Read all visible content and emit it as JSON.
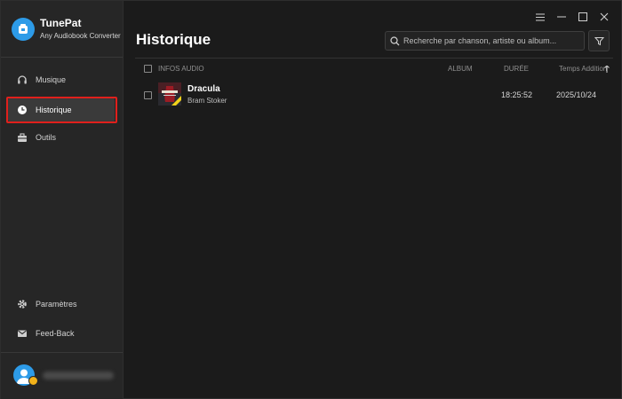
{
  "app": {
    "name": "TunePat",
    "subtitle": "Any Audiobook Converter"
  },
  "sidebar": {
    "items": [
      {
        "label": "Musique",
        "icon": "headphones-icon"
      },
      {
        "label": "Historique",
        "icon": "clock-icon",
        "active": true
      },
      {
        "label": "Outils",
        "icon": "toolbox-icon"
      }
    ],
    "bottom_items": [
      {
        "label": "Paramètres",
        "icon": "gear-icon"
      },
      {
        "label": "Feed-Back",
        "icon": "mail-icon"
      }
    ]
  },
  "main": {
    "title": "Historique",
    "search": {
      "placeholder": "Recherche par chanson, artiste ou album..."
    },
    "table": {
      "headers": {
        "info": "INFOS AUDIO",
        "album": "ALBUM",
        "duration": "DURÉE",
        "added": "Temps Addition"
      },
      "rows": [
        {
          "title": "Dracula",
          "artist": "Bram Stoker",
          "album": "",
          "duration": "18:25:52",
          "added": "2025/10/24"
        }
      ]
    }
  },
  "colors": {
    "accent": "#2d9be8",
    "highlight": "#e0201c",
    "sidebar_bg": "#262626",
    "main_bg": "#1b1b1b"
  }
}
